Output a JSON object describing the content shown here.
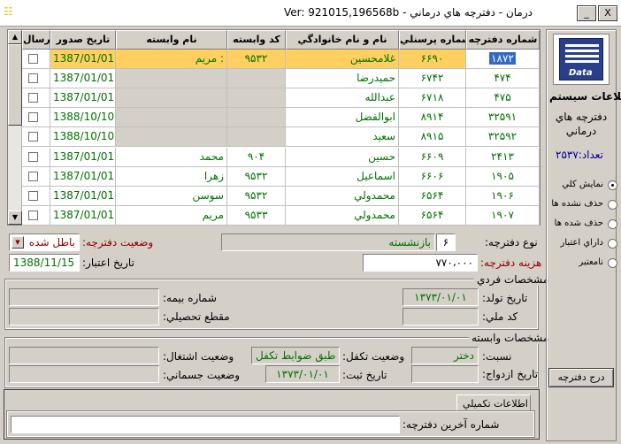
{
  "window": {
    "title": "Ver: 921015,196568b  -  درمان - دفترچه هاي درماني",
    "minimize": "_",
    "close": "X"
  },
  "grid": {
    "headers": {
      "number": "شماره دفترچه",
      "personnel": "شماره پرسنلي",
      "name": "نام و نام خانوادگي",
      "dep_code": "كد وابسته",
      "dep_name": "نام وابسته",
      "date": "تاريخ صدور",
      "send": "ارسال"
    },
    "rows": [
      {
        "number": "۱۸۷۲",
        "personnel": "۶۶۹۰",
        "name": "غلامحسين",
        "dep_code": "۹۵۳۲",
        "dep_name": "مريم :",
        "date": "1387/01/01"
      },
      {
        "number": "۴۷۴",
        "personnel": "۶۷۴۲",
        "name": "حميدرضا",
        "dep_code": "",
        "dep_name": "",
        "date": "1387/01/01"
      },
      {
        "number": "۴۷۵",
        "personnel": "۶۷۱۸",
        "name": "عبدالله",
        "dep_code": "",
        "dep_name": "",
        "date": "1387/01/01"
      },
      {
        "number": "۳۲۵۹۱",
        "personnel": "۸۹۱۴",
        "name": "ابوالفضل",
        "dep_code": "",
        "dep_name": "",
        "date": "1388/10/10"
      },
      {
        "number": "۳۲۵۹۲",
        "personnel": "۸۹۱۵",
        "name": "سعيد",
        "dep_code": "",
        "dep_name": "",
        "date": "1388/10/10"
      },
      {
        "number": "۲۴۱۳",
        "personnel": "۶۶۰۹",
        "name": "حسين",
        "dep_code": "۹۰۴",
        "dep_name": "محمد",
        "date": "1387/01/01"
      },
      {
        "number": "۱۹۰۵",
        "personnel": "۶۶۰۶",
        "name": "اسماعيل",
        "dep_code": "۹۵۳۲",
        "dep_name": "زهرا",
        "date": "1387/01/01"
      },
      {
        "number": "۱۹۰۶",
        "personnel": "۶۵۶۴",
        "name": "محمدولي",
        "dep_code": "۹۵۳۲",
        "dep_name": "سوسن",
        "date": "1387/01/01"
      },
      {
        "number": "۱۹۰۷",
        "personnel": "۶۵۶۴",
        "name": "محمدولي",
        "dep_code": "۹۵۳۳",
        "dep_name": "مريم",
        "date": "1387/01/01"
      }
    ]
  },
  "form": {
    "type_label": "نوع دفترچه:",
    "type_value": "بازنشسته",
    "type_code": "۶",
    "status_label": "وضعيت دفترچه:",
    "status_value": "باطل شده",
    "cost_label": "هزينه دفترچه:",
    "cost_value": "۷۷۰،۰۰۰",
    "validity_label": "تاريخ اعتبار:",
    "validity_value": "1388/11/15"
  },
  "personal": {
    "title": "مشخصات فردي",
    "birth_label": "تاريخ تولد:",
    "birth_value": "۱۳۷۳/۰۱/۰۱",
    "insurance_label": "شماره بيمه:",
    "national_label": "كد ملي:",
    "education_label": "مقطع تحصيلي:"
  },
  "dependent": {
    "title": "مشخصات وابسته",
    "relation_label": "نسبت:",
    "relation_value": "دختر",
    "support_label": "وضعيت تكفل:",
    "support_value": "طبق ضوابط تكفل",
    "job_label": "وضعيت اشتغال:",
    "marriage_label": "تاريخ ازدواج:",
    "reg_label": "تاريخ ثبت:",
    "reg_value": "۱۳۷۳/۰۱/۰۱",
    "physical_label": "وضعيت جسماني:"
  },
  "extra": {
    "title": "اطلاعات تكميلي",
    "last_label": "شماره آخرين دفترچه:"
  },
  "side": {
    "logo_text": "Data",
    "title": "اطلاعات سيستم",
    "subtitle": "دفترچه هاي درماني",
    "count": "تعداد:۲۵۳۷",
    "radios": [
      "نمايش كلي",
      "حذف نشده ها",
      "حذف شده ها",
      "داراي اعتبار",
      "نامعتبر"
    ],
    "insert_button": "درج دفترچه"
  }
}
